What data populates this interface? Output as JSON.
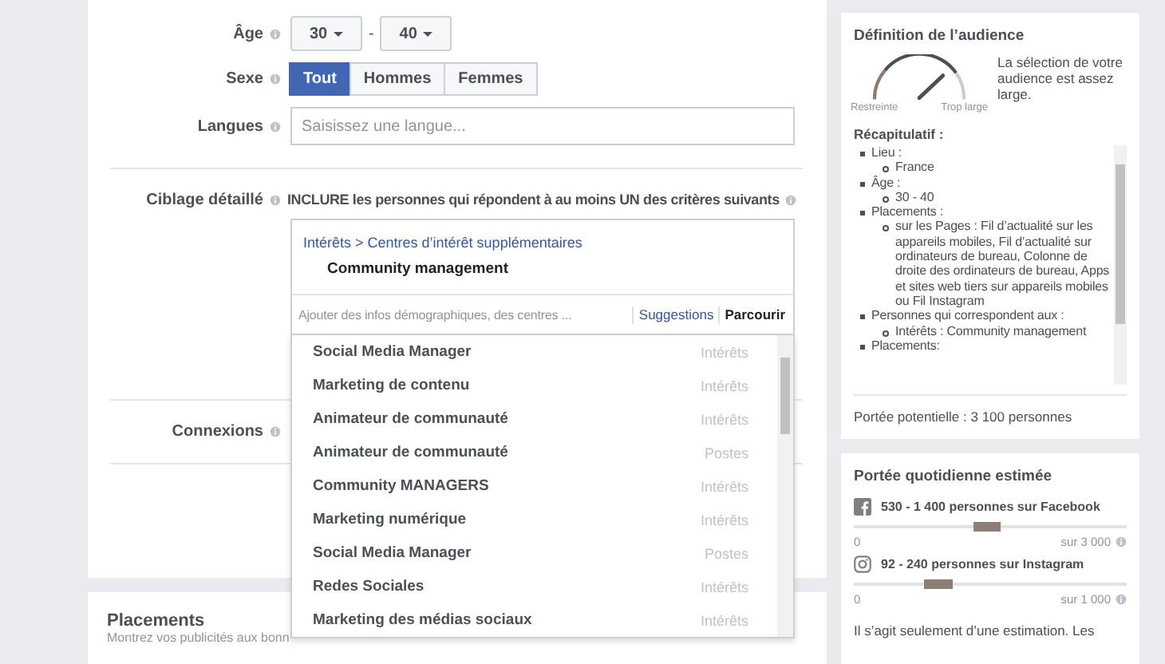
{
  "targeting": {
    "age": {
      "label": "Âge",
      "min": "30",
      "separator": "-",
      "max": "40"
    },
    "gender": {
      "label": "Sexe",
      "options": [
        {
          "label": "Tout",
          "selected": true
        },
        {
          "label": "Hommes",
          "selected": false
        },
        {
          "label": "Femmes",
          "selected": false
        }
      ]
    },
    "languages": {
      "label": "Langues",
      "placeholder": "Saisissez une langue..."
    },
    "detailed": {
      "label": "Ciblage détaillé",
      "instruction": "INCLURE les personnes qui répondent à au moins UN des critères suivants",
      "breadcrumb": "Intérêts > Centres d’intérêt supplémentaires",
      "selected_items": [
        "Community management"
      ],
      "search_placeholder": "Ajouter des infos démographiques, des centres ...",
      "links": [
        {
          "label": "Suggestions",
          "selected": true
        },
        {
          "label": "Parcourir",
          "selected": false
        }
      ],
      "suggestions": [
        {
          "name": "Social Media Manager",
          "type": "Intérêts"
        },
        {
          "name": "Marketing de contenu",
          "type": "Intérêts"
        },
        {
          "name": "Animateur de communauté",
          "type": "Intérêts"
        },
        {
          "name": "Animateur de communauté",
          "type": "Postes"
        },
        {
          "name": "Community MANAGERS",
          "type": "Intérêts"
        },
        {
          "name": "Marketing numérique",
          "type": "Intérêts"
        },
        {
          "name": "Social Media Manager",
          "type": "Postes"
        },
        {
          "name": "Redes Sociales",
          "type": "Intérêts"
        },
        {
          "name": "Marketing des médias sociaux",
          "type": "Intérêts"
        }
      ]
    },
    "connections": {
      "label": "Connexions"
    }
  },
  "placements": {
    "title": "Placements",
    "description": "Montrez vos publicités aux bonn"
  },
  "audience": {
    "title": "Définition de l’audience",
    "gauge_labels": [
      "Restreinte",
      "Trop large"
    ],
    "verdict": "La sélection de votre audience est assez large.",
    "summary_title": "Récapitulatif :",
    "summary": [
      {
        "text": "Lieu :",
        "children": [
          {
            "text": "France"
          }
        ]
      },
      {
        "text": "Âge :",
        "children": [
          {
            "text": "30 - 40"
          }
        ]
      },
      {
        "text": "Placements :",
        "children": [
          {
            "text": "sur les Pages : Fil d’actualité sur les appareils mobiles, Fil d’actualité sur ordinateurs de bureau, Colonne de droite des ordinateurs de bureau, Apps et sites web tiers sur appareils mobiles ou Fil Instagram"
          }
        ]
      },
      {
        "text": "Personnes qui correspondent aux :",
        "children": [
          {
            "text": "Intérêts : Community management"
          }
        ]
      },
      {
        "text": "Placements:"
      }
    ],
    "potential_reach": "Portée potentielle : 3 100 personnes"
  },
  "daily_reach": {
    "title": "Portée quotidienne estimée",
    "platforms": [
      {
        "kind": "facebook",
        "text": "530 - 1 400 personnes sur Facebook",
        "min": "0",
        "max": "sur 3 000"
      },
      {
        "kind": "instagram",
        "text": "92 - 240 personnes sur Instagram",
        "min": "0",
        "max": "sur 1 000"
      }
    ],
    "note": "Il s’agit seulement d’une estimation. Les"
  }
}
